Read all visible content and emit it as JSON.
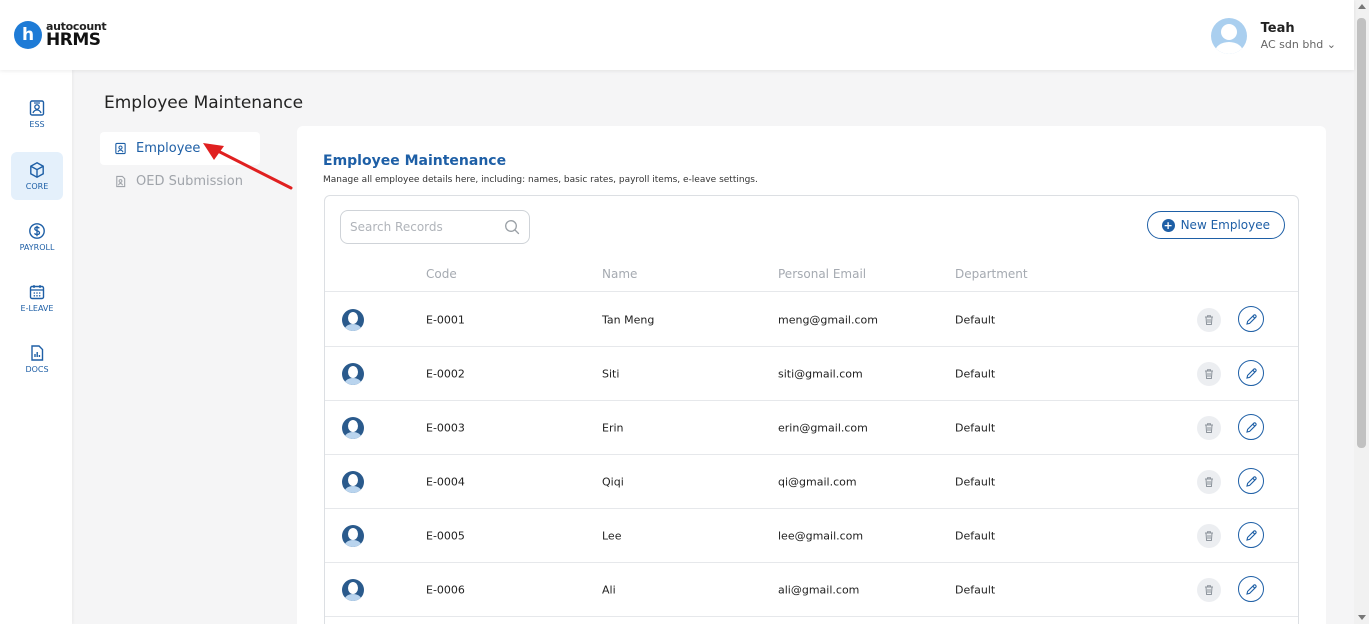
{
  "app": {
    "logo_letter": "h",
    "logo_top": "autocount",
    "logo_bottom": "HRMS"
  },
  "user": {
    "name": "Teah",
    "company": "AC sdn bhd ⌄"
  },
  "sidebar": {
    "items": [
      {
        "label": "ESS",
        "icon": "id-card-icon"
      },
      {
        "label": "CORE",
        "icon": "cube-icon"
      },
      {
        "label": "PAYROLL",
        "icon": "dollar-icon"
      },
      {
        "label": "E-LEAVE",
        "icon": "calendar-icon"
      },
      {
        "label": "DOCS",
        "icon": "document-icon"
      }
    ]
  },
  "page": {
    "title": "Employee Maintenance"
  },
  "subnav": {
    "items": [
      {
        "label": "Employee"
      },
      {
        "label": "OED Submission"
      }
    ]
  },
  "main": {
    "title": "Employee Maintenance",
    "description": "Manage all employee details here, including: names, basic rates, payroll items, e-leave settings.",
    "search_placeholder": "Search Records",
    "new_button_label": "New Employee",
    "columns": {
      "code": "Code",
      "name": "Name",
      "email": "Personal Email",
      "department": "Department"
    },
    "rows": [
      {
        "code": "E-0001",
        "name": "Tan Meng",
        "email": "meng@gmail.com",
        "department": "Default"
      },
      {
        "code": "E-0002",
        "name": "Siti",
        "email": "siti@gmail.com",
        "department": "Default"
      },
      {
        "code": "E-0003",
        "name": "Erin",
        "email": "erin@gmail.com",
        "department": "Default"
      },
      {
        "code": "E-0004",
        "name": "Qiqi",
        "email": "qi@gmail.com",
        "department": "Default"
      },
      {
        "code": "E-0005",
        "name": "Lee",
        "email": "lee@gmail.com",
        "department": "Default"
      },
      {
        "code": "E-0006",
        "name": "Ali",
        "email": "ali@gmail.com",
        "department": "Default"
      }
    ]
  },
  "colors": {
    "primary": "#1e5fa6",
    "logo": "#1e7bd6",
    "annotation_arrow": "#e02020"
  }
}
